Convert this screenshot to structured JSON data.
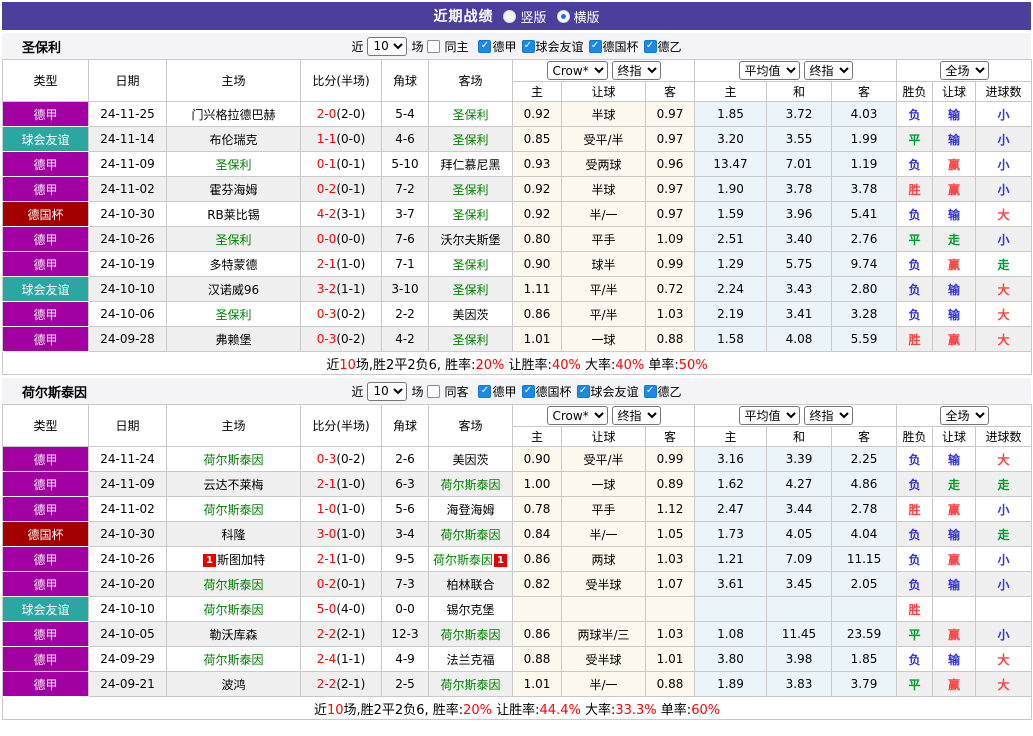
{
  "icons": {
    "check": "✓",
    "dropdown_arrow": "▾"
  },
  "topbar": {
    "title": "近期战绩",
    "bg": "#4b3f9e",
    "options": [
      {
        "label": "竖版",
        "selected": false
      },
      {
        "label": "横版",
        "selected": true
      }
    ]
  },
  "table_header": {
    "cols": [
      "类型",
      "日期",
      "主场",
      "比分(半场)",
      "角球",
      "客场"
    ],
    "sub": [
      "主",
      "让球",
      "客",
      "主",
      "和",
      "客",
      "胜负",
      "让球",
      "进球数"
    ],
    "selects": {
      "company": "Crow*",
      "final_a": "终指",
      "average": "平均值",
      "final_b": "终指",
      "scope": "全场"
    }
  },
  "colors": {
    "league": {
      "德甲": "#a300a3",
      "球会友谊": "#2aa7a1",
      "德国杯": "#a30000",
      "德乙": "#a300a3"
    },
    "result": {
      "red": "#ff4242",
      "blue": "#3434d6",
      "green": "#009933"
    },
    "score_red": "#ff0000",
    "team_green": "#008000",
    "odds_bg": "#fdf8ee",
    "avg_bg": "#eaf4f9",
    "stripe": "#efefef"
  },
  "sections": [
    {
      "team": "圣保利",
      "filter": {
        "prefix": "近",
        "count": "10",
        "suffix": "场",
        "same_label": "同主",
        "same_checked": false,
        "leagues": [
          {
            "label": "德甲",
            "checked": true
          },
          {
            "label": "球会友谊",
            "checked": true
          },
          {
            "label": "德国杯",
            "checked": true
          },
          {
            "label": "德乙",
            "checked": true
          }
        ]
      },
      "rows": [
        {
          "league": "德甲",
          "date": "24-11-25",
          "home": {
            "name": "门兴格拉德巴赫",
            "self": false
          },
          "score_full": "2-0",
          "score_half": "(2-0)",
          "corner": "5-4",
          "away": {
            "name": "圣保利",
            "self": true
          },
          "odds": [
            "0.92",
            "半球",
            "0.97"
          ],
          "avg": [
            "1.85",
            "3.72",
            "4.03"
          ],
          "results": [
            {
              "t": "负",
              "c": "blue"
            },
            {
              "t": "输",
              "c": "blue"
            },
            {
              "t": "小",
              "c": "blue"
            }
          ]
        },
        {
          "league": "球会友谊",
          "date": "24-11-14",
          "home": {
            "name": "布伦瑞克",
            "self": false
          },
          "score_full": "1-1",
          "score_half": "(0-0)",
          "corner": "4-6",
          "away": {
            "name": "圣保利",
            "self": true
          },
          "odds": [
            "0.85",
            "受平/半",
            "0.97"
          ],
          "avg": [
            "3.20",
            "3.55",
            "1.99"
          ],
          "results": [
            {
              "t": "平",
              "c": "green"
            },
            {
              "t": "输",
              "c": "blue"
            },
            {
              "t": "小",
              "c": "blue"
            }
          ]
        },
        {
          "league": "德甲",
          "date": "24-11-09",
          "home": {
            "name": "圣保利",
            "self": true
          },
          "score_full": "0-1",
          "score_half": "(0-1)",
          "corner": "5-10",
          "away": {
            "name": "拜仁慕尼黑",
            "self": false
          },
          "odds": [
            "0.93",
            "受两球",
            "0.96"
          ],
          "avg": [
            "13.47",
            "7.01",
            "1.19"
          ],
          "results": [
            {
              "t": "负",
              "c": "blue"
            },
            {
              "t": "赢",
              "c": "red"
            },
            {
              "t": "小",
              "c": "blue"
            }
          ]
        },
        {
          "league": "德甲",
          "date": "24-11-02",
          "home": {
            "name": "霍芬海姆",
            "self": false
          },
          "score_full": "0-2",
          "score_half": "(0-1)",
          "corner": "7-2",
          "away": {
            "name": "圣保利",
            "self": true
          },
          "odds": [
            "0.92",
            "半球",
            "0.97"
          ],
          "avg": [
            "1.90",
            "3.78",
            "3.78"
          ],
          "results": [
            {
              "t": "胜",
              "c": "red"
            },
            {
              "t": "赢",
              "c": "red"
            },
            {
              "t": "小",
              "c": "blue"
            }
          ]
        },
        {
          "league": "德国杯",
          "date": "24-10-30",
          "home": {
            "name": "RB莱比锡",
            "self": false
          },
          "score_full": "4-2",
          "score_half": "(3-1)",
          "corner": "3-7",
          "away": {
            "name": "圣保利",
            "self": true
          },
          "odds": [
            "0.92",
            "半/一",
            "0.97"
          ],
          "avg": [
            "1.59",
            "3.96",
            "5.41"
          ],
          "results": [
            {
              "t": "负",
              "c": "blue"
            },
            {
              "t": "输",
              "c": "blue"
            },
            {
              "t": "大",
              "c": "red"
            }
          ]
        },
        {
          "league": "德甲",
          "date": "24-10-26",
          "home": {
            "name": "圣保利",
            "self": true
          },
          "score_full": "0-0",
          "score_half": "(0-0)",
          "corner": "7-6",
          "away": {
            "name": "沃尔夫斯堡",
            "self": false
          },
          "odds": [
            "0.80",
            "平手",
            "1.09"
          ],
          "avg": [
            "2.51",
            "3.40",
            "2.76"
          ],
          "results": [
            {
              "t": "平",
              "c": "green"
            },
            {
              "t": "走",
              "c": "green"
            },
            {
              "t": "小",
              "c": "blue"
            }
          ]
        },
        {
          "league": "德甲",
          "date": "24-10-19",
          "home": {
            "name": "多特蒙德",
            "self": false
          },
          "score_full": "2-1",
          "score_half": "(1-0)",
          "corner": "7-1",
          "away": {
            "name": "圣保利",
            "self": true
          },
          "odds": [
            "0.90",
            "球半",
            "0.99"
          ],
          "avg": [
            "1.29",
            "5.75",
            "9.74"
          ],
          "results": [
            {
              "t": "负",
              "c": "blue"
            },
            {
              "t": "赢",
              "c": "red"
            },
            {
              "t": "走",
              "c": "green"
            }
          ]
        },
        {
          "league": "球会友谊",
          "date": "24-10-10",
          "home": {
            "name": "汉诺威96",
            "self": false
          },
          "score_full": "3-2",
          "score_half": "(1-1)",
          "corner": "3-10",
          "away": {
            "name": "圣保利",
            "self": true
          },
          "odds": [
            "1.11",
            "平/半",
            "0.72"
          ],
          "avg": [
            "2.24",
            "3.43",
            "2.80"
          ],
          "results": [
            {
              "t": "负",
              "c": "blue"
            },
            {
              "t": "输",
              "c": "blue"
            },
            {
              "t": "大",
              "c": "red"
            }
          ]
        },
        {
          "league": "德甲",
          "date": "24-10-06",
          "home": {
            "name": "圣保利",
            "self": true
          },
          "score_full": "0-3",
          "score_half": "(0-2)",
          "corner": "2-2",
          "away": {
            "name": "美因茨",
            "self": false
          },
          "odds": [
            "0.86",
            "平/半",
            "1.03"
          ],
          "avg": [
            "2.19",
            "3.41",
            "3.28"
          ],
          "results": [
            {
              "t": "负",
              "c": "blue"
            },
            {
              "t": "输",
              "c": "blue"
            },
            {
              "t": "大",
              "c": "red"
            }
          ]
        },
        {
          "league": "德甲",
          "date": "24-09-28",
          "home": {
            "name": "弗赖堡",
            "self": false
          },
          "score_full": "0-3",
          "score_half": "(0-2)",
          "corner": "4-2",
          "away": {
            "name": "圣保利",
            "self": true
          },
          "odds": [
            "1.01",
            "一球",
            "0.88"
          ],
          "avg": [
            "1.58",
            "4.08",
            "5.59"
          ],
          "results": [
            {
              "t": "胜",
              "c": "red"
            },
            {
              "t": "赢",
              "c": "red"
            },
            {
              "t": "大",
              "c": "red"
            }
          ]
        }
      ],
      "summary_parts": [
        {
          "t": "近",
          "c": "k"
        },
        {
          "t": "10",
          "c": "r"
        },
        {
          "t": "场,胜2平2负6, 胜率:",
          "c": "k"
        },
        {
          "t": "20%",
          "c": "r"
        },
        {
          "t": " 让胜率:",
          "c": "k"
        },
        {
          "t": "40%",
          "c": "r"
        },
        {
          "t": " 大率:",
          "c": "k"
        },
        {
          "t": "40%",
          "c": "r"
        },
        {
          "t": " 单率:",
          "c": "k"
        },
        {
          "t": "50%",
          "c": "r"
        }
      ]
    },
    {
      "team": "荷尔斯泰因",
      "filter": {
        "prefix": "近",
        "count": "10",
        "suffix": "场",
        "same_label": "同客",
        "same_checked": false,
        "leagues": [
          {
            "label": "德甲",
            "checked": true
          },
          {
            "label": "德国杯",
            "checked": true
          },
          {
            "label": "球会友谊",
            "checked": true
          },
          {
            "label": "德乙",
            "checked": true
          }
        ]
      },
      "rows": [
        {
          "league": "德甲",
          "date": "24-11-24",
          "home": {
            "name": "荷尔斯泰因",
            "self": true
          },
          "score_full": "0-3",
          "score_half": "(0-2)",
          "corner": "2-6",
          "away": {
            "name": "美因茨",
            "self": false
          },
          "odds": [
            "0.90",
            "受平/半",
            "0.99"
          ],
          "avg": [
            "3.16",
            "3.39",
            "2.25"
          ],
          "results": [
            {
              "t": "负",
              "c": "blue"
            },
            {
              "t": "输",
              "c": "blue"
            },
            {
              "t": "大",
              "c": "red"
            }
          ]
        },
        {
          "league": "德甲",
          "date": "24-11-09",
          "home": {
            "name": "云达不莱梅",
            "self": false
          },
          "score_full": "2-1",
          "score_half": "(1-0)",
          "corner": "6-3",
          "away": {
            "name": "荷尔斯泰因",
            "self": true
          },
          "odds": [
            "1.00",
            "一球",
            "0.89"
          ],
          "avg": [
            "1.62",
            "4.27",
            "4.86"
          ],
          "results": [
            {
              "t": "负",
              "c": "blue"
            },
            {
              "t": "走",
              "c": "green"
            },
            {
              "t": "走",
              "c": "green"
            }
          ]
        },
        {
          "league": "德甲",
          "date": "24-11-02",
          "home": {
            "name": "荷尔斯泰因",
            "self": true
          },
          "score_full": "1-0",
          "score_half": "(1-0)",
          "corner": "5-6",
          "away": {
            "name": "海登海姆",
            "self": false
          },
          "odds": [
            "0.78",
            "平手",
            "1.12"
          ],
          "avg": [
            "2.47",
            "3.44",
            "2.78"
          ],
          "results": [
            {
              "t": "胜",
              "c": "red"
            },
            {
              "t": "赢",
              "c": "red"
            },
            {
              "t": "小",
              "c": "blue"
            }
          ]
        },
        {
          "league": "德国杯",
          "date": "24-10-30",
          "home": {
            "name": "科隆",
            "self": false
          },
          "score_full": "3-0",
          "score_half": "(1-0)",
          "corner": "3-4",
          "away": {
            "name": "荷尔斯泰因",
            "self": true
          },
          "odds": [
            "0.84",
            "半/一",
            "1.05"
          ],
          "avg": [
            "1.73",
            "4.05",
            "4.04"
          ],
          "results": [
            {
              "t": "负",
              "c": "blue"
            },
            {
              "t": "输",
              "c": "blue"
            },
            {
              "t": "走",
              "c": "green"
            }
          ]
        },
        {
          "league": "德甲",
          "date": "24-10-26",
          "home": {
            "name": "斯图加特",
            "self": false,
            "badge_before": "1"
          },
          "score_full": "2-1",
          "score_half": "(1-0)",
          "corner": "9-5",
          "away": {
            "name": "荷尔斯泰因",
            "self": true,
            "badge_after": "1"
          },
          "odds": [
            "0.86",
            "两球",
            "1.03"
          ],
          "avg": [
            "1.21",
            "7.09",
            "11.15"
          ],
          "results": [
            {
              "t": "负",
              "c": "blue"
            },
            {
              "t": "赢",
              "c": "red"
            },
            {
              "t": "小",
              "c": "blue"
            }
          ]
        },
        {
          "league": "德甲",
          "date": "24-10-20",
          "home": {
            "name": "荷尔斯泰因",
            "self": true
          },
          "score_full": "0-2",
          "score_half": "(0-1)",
          "corner": "7-3",
          "away": {
            "name": "柏林联合",
            "self": false
          },
          "odds": [
            "0.82",
            "受半球",
            "1.07"
          ],
          "avg": [
            "3.61",
            "3.45",
            "2.05"
          ],
          "results": [
            {
              "t": "负",
              "c": "blue"
            },
            {
              "t": "输",
              "c": "blue"
            },
            {
              "t": "小",
              "c": "blue"
            }
          ]
        },
        {
          "league": "球会友谊",
          "date": "24-10-10",
          "home": {
            "name": "荷尔斯泰因",
            "self": true
          },
          "score_full": "5-0",
          "score_half": "(4-0)",
          "corner": "0-0",
          "away": {
            "name": "锡尔克堡",
            "self": false
          },
          "odds": [
            "",
            "",
            ""
          ],
          "avg": [
            "",
            "",
            ""
          ],
          "results": [
            {
              "t": "胜",
              "c": "red"
            },
            {
              "t": "",
              "c": "k"
            },
            {
              "t": "",
              "c": "k"
            }
          ]
        },
        {
          "league": "德甲",
          "date": "24-10-05",
          "home": {
            "name": "勒沃库森",
            "self": false
          },
          "score_full": "2-2",
          "score_half": "(2-1)",
          "corner": "12-3",
          "away": {
            "name": "荷尔斯泰因",
            "self": true
          },
          "odds": [
            "0.86",
            "两球半/三",
            "1.03"
          ],
          "avg": [
            "1.08",
            "11.45",
            "23.59"
          ],
          "results": [
            {
              "t": "平",
              "c": "green"
            },
            {
              "t": "赢",
              "c": "red"
            },
            {
              "t": "小",
              "c": "blue"
            }
          ]
        },
        {
          "league": "德甲",
          "date": "24-09-29",
          "home": {
            "name": "荷尔斯泰因",
            "self": true
          },
          "score_full": "2-4",
          "score_half": "(1-1)",
          "corner": "4-9",
          "away": {
            "name": "法兰克福",
            "self": false
          },
          "odds": [
            "0.88",
            "受半球",
            "1.01"
          ],
          "avg": [
            "3.80",
            "3.98",
            "1.85"
          ],
          "results": [
            {
              "t": "负",
              "c": "blue"
            },
            {
              "t": "输",
              "c": "blue"
            },
            {
              "t": "大",
              "c": "red"
            }
          ]
        },
        {
          "league": "德甲",
          "date": "24-09-21",
          "home": {
            "name": "波鸿",
            "self": false
          },
          "score_full": "2-2",
          "score_half": "(2-1)",
          "corner": "2-5",
          "away": {
            "name": "荷尔斯泰因",
            "self": true
          },
          "odds": [
            "1.01",
            "半/一",
            "0.88"
          ],
          "avg": [
            "1.89",
            "3.83",
            "3.79"
          ],
          "results": [
            {
              "t": "平",
              "c": "green"
            },
            {
              "t": "赢",
              "c": "red"
            },
            {
              "t": "大",
              "c": "red"
            }
          ]
        }
      ],
      "summary_parts": [
        {
          "t": "近",
          "c": "k"
        },
        {
          "t": "10",
          "c": "r"
        },
        {
          "t": "场,胜2平2负6, 胜率:",
          "c": "k"
        },
        {
          "t": "20%",
          "c": "r"
        },
        {
          "t": " 让胜率:",
          "c": "k"
        },
        {
          "t": "44.4%",
          "c": "r"
        },
        {
          "t": " 大率:",
          "c": "k"
        },
        {
          "t": "33.3%",
          "c": "r"
        },
        {
          "t": " 单率:",
          "c": "k"
        },
        {
          "t": "60%",
          "c": "r"
        }
      ]
    }
  ]
}
